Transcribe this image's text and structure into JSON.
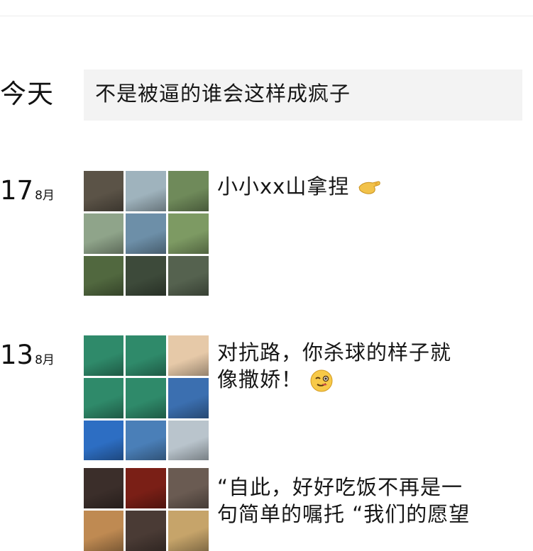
{
  "posts": [
    {
      "date_label": "今天",
      "text": "不是被逼的谁会这样成疯子"
    },
    {
      "day": "17",
      "month": "8月",
      "text": "小小xx山拿捏",
      "emoji": "pinching-hand-icon",
      "thumb_colors": [
        "#5b5347",
        "#9fb3bd",
        "#6f8a5a",
        "#8fa48a",
        "#6d8fa8",
        "#7d9a63",
        "#51683f",
        "#3d4a3a",
        "#55624f"
      ]
    },
    {
      "day": "13",
      "month": "8月",
      "text_lines": [
        "对抗路，你杀球的样子就",
        "像撒娇！"
      ],
      "emoji": "winking-face-icon",
      "thumb_colors": [
        "#2f8a6a",
        "#2f8a6a",
        "#e6c9a8",
        "#2f8a6a",
        "#2f8a6a",
        "#3b6fb0",
        "#2d6ec3",
        "#4a7fb8",
        "#b9c4cc"
      ]
    },
    {
      "text_lines": [
        "“自此，好好吃饭不再是一",
        "句简单的嘱托 “我们的愿望"
      ],
      "thumb_colors": [
        "#3b2e2a",
        "#7a1f16",
        "#6a5b52",
        "#bf8a52",
        "#4a3b35",
        "#c6a46a"
      ]
    }
  ]
}
